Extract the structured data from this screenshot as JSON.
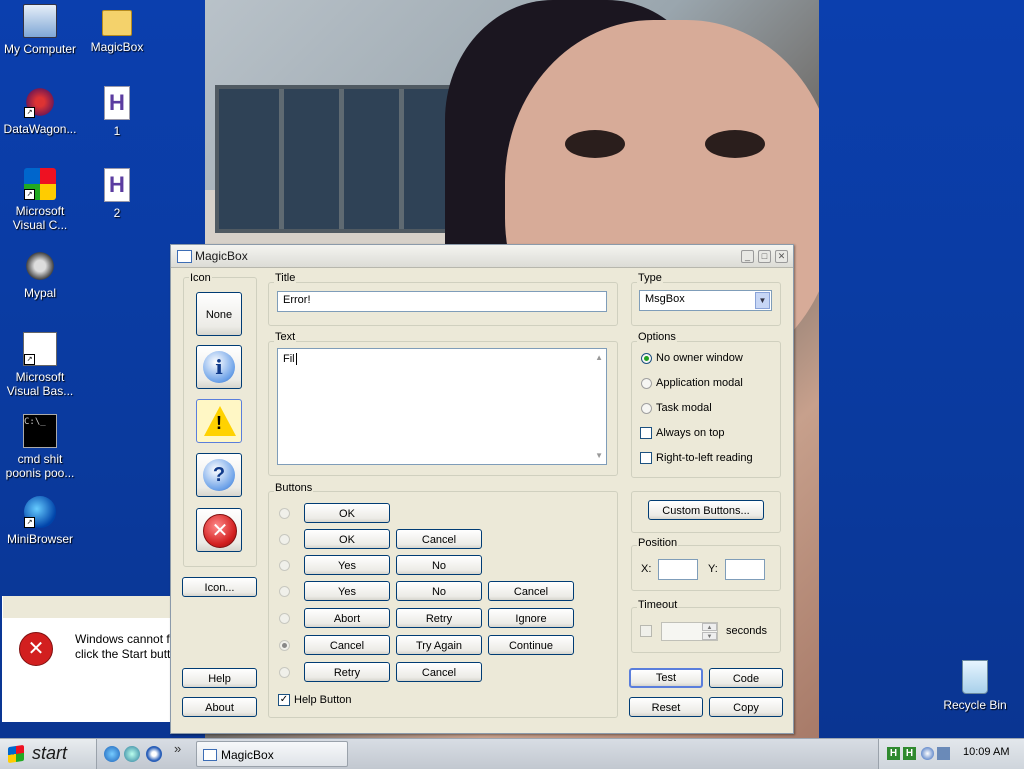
{
  "desktop": {
    "icons": [
      {
        "label": "My Computer",
        "icon": "computer-icon"
      },
      {
        "label": "MagicBox",
        "icon": "folder-icon"
      },
      {
        "label": "DataWagon...",
        "icon": "datawagon-icon"
      },
      {
        "label": "1",
        "icon": "h-file-icon"
      },
      {
        "label": "Microsoft Visual C...",
        "icon": "visual-studio-icon"
      },
      {
        "label": "2",
        "icon": "h-file-icon"
      },
      {
        "label": "Mypal",
        "icon": "mypal-icon"
      },
      {
        "label": "Microsoft Visual Bas...",
        "icon": "visual-basic-icon"
      },
      {
        "label": "cmd shit poonis poo...",
        "icon": "cmd-icon"
      },
      {
        "label": "MiniBrowser",
        "icon": "globe-icon"
      },
      {
        "label": "Recycle Bin",
        "icon": "recycle-bin-icon"
      }
    ],
    "cmd_glyph": "C:\\_",
    "file_glyph": "H"
  },
  "error_dialog": {
    "line1": "Windows cannot f",
    "line2": "click the Start butt",
    "glyph": "✕"
  },
  "window": {
    "title": "MagicBox",
    "controls": [
      "_",
      "□",
      "✕"
    ],
    "icon_group": {
      "label": "Icon",
      "none_label": "None",
      "options": [
        "info-icon",
        "warning-icon",
        "question-icon",
        "error-icon"
      ],
      "selected": "warning-icon",
      "glyphs": {
        "info": "i",
        "warning": "!",
        "question": "?",
        "error": "✕"
      },
      "icon_button": "Icon..."
    },
    "title_group": {
      "label": "Title",
      "value": "Error!"
    },
    "text_group": {
      "label": "Text",
      "value": "Fil"
    },
    "type_group": {
      "label": "Type",
      "value": "MsgBox"
    },
    "options_group": {
      "label": "Options",
      "radios": [
        "No owner window",
        "Application modal",
        "Task modal"
      ],
      "selected": "No owner window",
      "checks": [
        "Always on top",
        "Right-to-left reading"
      ]
    },
    "buttons_group": {
      "label": "Buttons",
      "rows": [
        [
          "OK"
        ],
        [
          "OK",
          "Cancel"
        ],
        [
          "Yes",
          "No"
        ],
        [
          "Yes",
          "No",
          "Cancel"
        ],
        [
          "Abort",
          "Retry",
          "Ignore"
        ],
        [
          "Cancel",
          "Try Again",
          "Continue"
        ],
        [
          "Retry",
          "Cancel"
        ]
      ],
      "selected_row": 5,
      "help_button": "Help Button",
      "help_checked": true
    },
    "custom_buttons": "Custom Buttons...",
    "position_group": {
      "label": "Position",
      "x_label": "X:",
      "y_label": "Y:",
      "x": "",
      "y": ""
    },
    "timeout_group": {
      "label": "Timeout",
      "value": "",
      "unit": "seconds"
    },
    "help": "Help",
    "about": "About",
    "test": "Test",
    "code": "Code",
    "reset": "Reset",
    "copy": "Copy",
    "spin_up": "▲",
    "spin_down": "▼",
    "dropdown_arrow": "▼",
    "check_mark": "✓"
  },
  "taskbar": {
    "start": "start",
    "task": "MagicBox",
    "chevron": "»",
    "tray_icons": [
      "H",
      "H"
    ],
    "clock": "10:09 AM"
  }
}
